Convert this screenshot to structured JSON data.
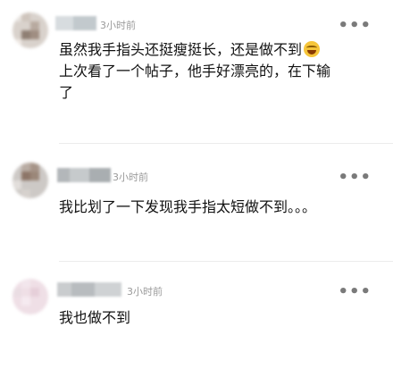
{
  "comments": [
    {
      "time": "3小时前",
      "more": "•••",
      "lines": [
        "虽然我手指头还挺瘦挺长，还是做不到",
        "上次看了一个帖子，他手好漂亮的，在下输",
        "了"
      ],
      "emoji": "laughing-crying-emoji"
    },
    {
      "time": "3小时前",
      "more": "•••",
      "lines": [
        "我比划了一下发现我手指太短做不到。。。"
      ]
    },
    {
      "time": "3小时前",
      "more": "•••",
      "lines": [
        "我也做不到"
      ]
    }
  ]
}
